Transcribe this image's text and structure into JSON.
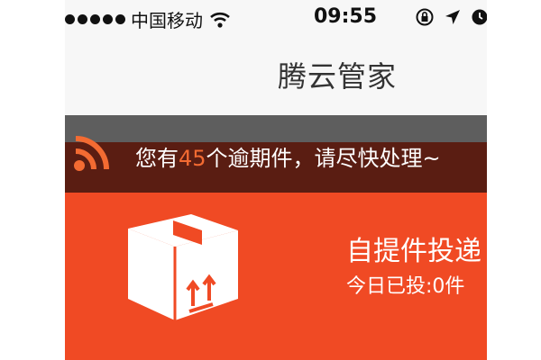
{
  "status_bar": {
    "carrier": "中国移动",
    "time": "09:55"
  },
  "header": {
    "title": "腾云管家"
  },
  "notice": {
    "prefix": "您有",
    "count": "45",
    "suffix": "个逾期件，请尽快处理~",
    "icon": "rss-icon"
  },
  "delivery_card": {
    "title": "自提件投递",
    "subtitle": "今日已投:0件",
    "icon": "package-box-icon"
  },
  "colors": {
    "card_background": "#f04a24",
    "notice_background": "#5a1d12",
    "accent_orange": "#f36b32"
  }
}
